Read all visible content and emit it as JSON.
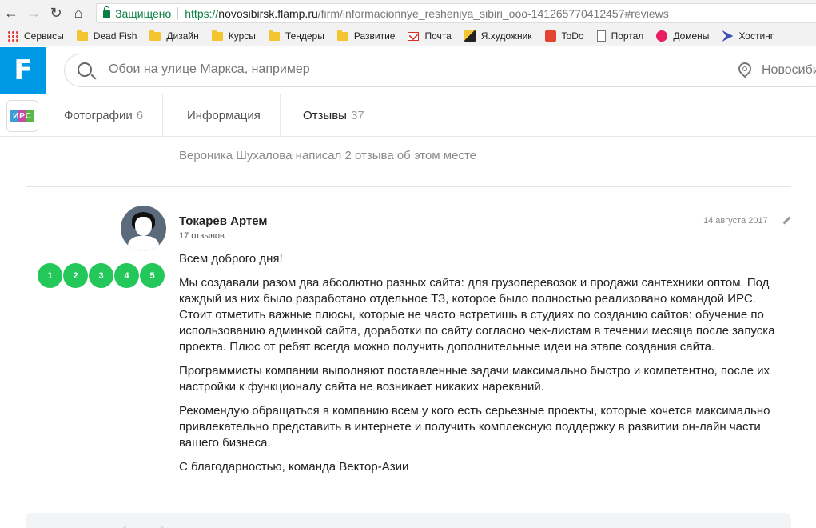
{
  "browser": {
    "secure_label": "Защищено",
    "url_scheme": "https://",
    "url_host": "novosibirsk.flamp.ru",
    "url_path": "/firm/informacionnye_resheniya_sibiri_ooo-141265770412457#reviews",
    "bookmarks": [
      {
        "label": "Сервисы",
        "icon": "apps-icon"
      },
      {
        "label": "Dead Fish",
        "icon": "folder-icon"
      },
      {
        "label": "Дизайн",
        "icon": "folder-icon"
      },
      {
        "label": "Курсы",
        "icon": "folder-icon"
      },
      {
        "label": "Тендеры",
        "icon": "folder-icon"
      },
      {
        "label": "Развитие",
        "icon": "folder-icon"
      },
      {
        "label": "Почта",
        "icon": "mail-icon"
      },
      {
        "label": "Я.художник",
        "icon": "art-icon"
      },
      {
        "label": "ToDo",
        "icon": "todo-icon"
      },
      {
        "label": "Портал",
        "icon": "doc-icon"
      },
      {
        "label": "Домены",
        "icon": "domain-icon"
      },
      {
        "label": "Хостинг",
        "icon": "host-icon"
      }
    ]
  },
  "site": {
    "logo_glyph": "F",
    "search_placeholder": "Обои на улице Маркса, например",
    "city": "Новосибирск"
  },
  "firm": {
    "logo_text": "ИРС",
    "tabs": [
      {
        "label": "Фотографии",
        "count": "6"
      },
      {
        "label": "Информация",
        "count": ""
      },
      {
        "label": "Отзывы",
        "count": "37"
      }
    ]
  },
  "author_note": "Вероника Шухалова написал 2 отзыва об этом месте",
  "review": {
    "author": "Токарев Артем",
    "author_reviews": "17 отзывов",
    "date": "14 августа 2017",
    "rating": 5,
    "rating_labels": [
      "1",
      "2",
      "3",
      "4",
      "5"
    ],
    "paragraphs": [
      "Всем доброго дня!",
      "Мы создавали разом два абсолютно разных сайта: для грузоперевозок и продажи сантехники оптом. Под каждый из них было разработано отдельное ТЗ, которое было полностью реализовано командой ИРС. Стоит отметить важные плюсы, которые не часто встретишь в студиях по созданию сайтов: обучение по использованию админкой сайта, доработки по сайту согласно чек-листам в течении месяца после запуска проекта. Плюс от ребят всегда можно получить дополнительные идеи на этапе создания сайта.",
      "Программисты компании выполняют поставленные задачи максимально быстро и компетентно, после их настройки к функционалу сайта не возникает никаких нареканий.",
      "Рекомендую обращаться в компанию всем у кого есть серьезные проекты, которые хочется максимально привлекательно представить в интернете и получить комплексную поддержку в развитии он-лайн части вашего бизнеса.",
      "С благодарностью, команда Вектор-Азии"
    ]
  },
  "colors": {
    "accent": "#0099e5",
    "rating": "#24c75a",
    "secure": "#0b8043"
  }
}
